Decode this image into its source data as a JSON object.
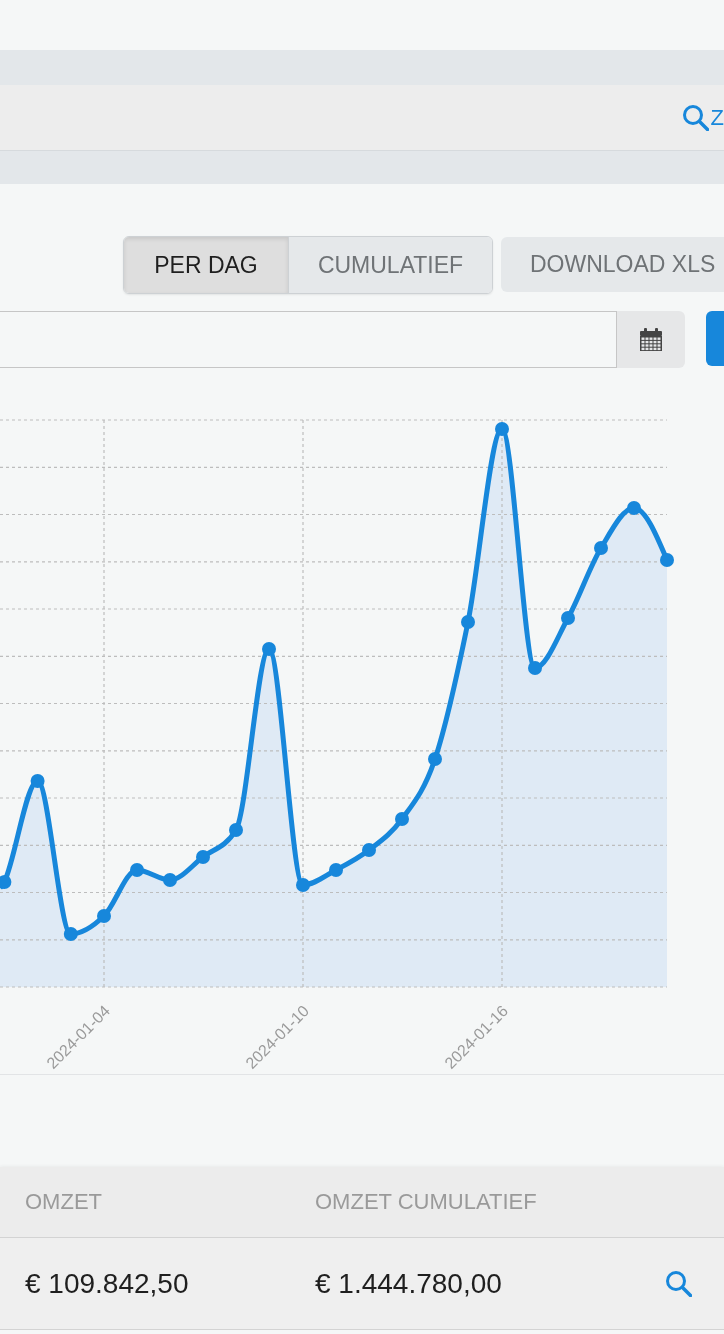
{
  "header": {
    "search_link": "Z"
  },
  "view_toggle": [
    {
      "label": "PER DAG",
      "selected": true
    },
    {
      "label": "CUMULATIEF",
      "selected": false
    }
  ],
  "download_button": "DOWNLOAD XLS",
  "chart": {
    "x_labels": [
      "2024-01-04",
      "2024-01-10",
      "2024-01-16"
    ]
  },
  "table": {
    "columns": [
      "OMZET",
      "OMZET CUMULATIEF"
    ],
    "rows": [
      {
        "cells": [
          "€ 109.842,50",
          "€ 1.444.780,00"
        ]
      }
    ]
  }
}
